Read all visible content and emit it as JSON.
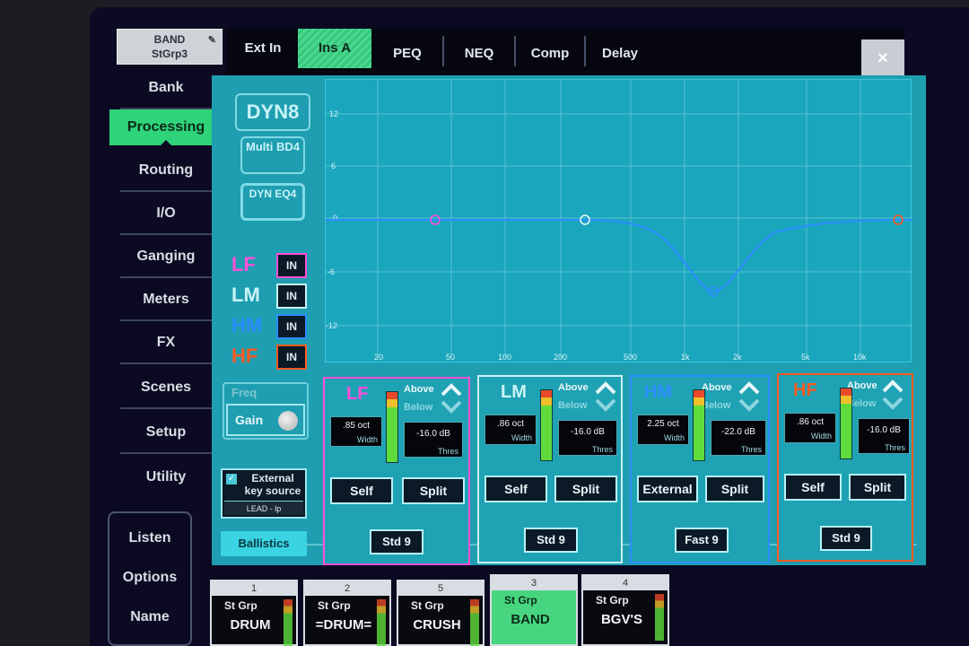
{
  "channel": {
    "line1": "BAND",
    "line2": "StGrp3"
  },
  "sidebar": {
    "items": [
      "Bank",
      "Processing",
      "Routing",
      "I/O",
      "Ganging",
      "Meters",
      "FX",
      "Scenes",
      "Setup",
      "Utility"
    ],
    "bottom": [
      "Listen",
      "Options",
      "Name"
    ]
  },
  "tabs": [
    "Ext In",
    "Ins A",
    "PEQ",
    "NEQ",
    "Comp",
    "Delay"
  ],
  "close_label": "×",
  "dyn_logos": [
    "DYN8",
    "Multi BD4",
    "DYN EQ4"
  ],
  "bands": [
    {
      "label": "LF",
      "in": "IN",
      "color": "#ff4fd8"
    },
    {
      "label": "LM",
      "in": "IN",
      "color": "#c9f2f6"
    },
    {
      "label": "HM",
      "in": "IN",
      "color": "#2b8dff"
    },
    {
      "label": "HF",
      "in": "IN",
      "color": "#ff5a22"
    }
  ],
  "freq_label": "Freq",
  "gain_label": "Gain",
  "external_key": {
    "line1": "External",
    "line2": "key source",
    "source": "LEAD - lp"
  },
  "ballistics_label": "Ballistics",
  "graph": {
    "y_ticks": [
      "12",
      "6",
      "0",
      "-6",
      "-12"
    ],
    "x_ticks": [
      "20",
      "50",
      "100",
      "200",
      "500",
      "1k",
      "2k",
      "5k",
      "10k"
    ]
  },
  "band_panels": [
    {
      "name": "LF",
      "above": "Above",
      "below": "Below",
      "width": ".85 oct",
      "width_unit": "Width",
      "thres": "-16.0 dB",
      "thres_unit": "Thres",
      "btn1": "Self",
      "btn2": "Split",
      "mode": "Std 9",
      "color": "#ff4fd8"
    },
    {
      "name": "LM",
      "above": "Above",
      "below": "Below",
      "width": ".86 oct",
      "width_unit": "Width",
      "thres": "-16.0 dB",
      "thres_unit": "Thres",
      "btn1": "Self",
      "btn2": "Split",
      "mode": "Std 9",
      "color": "#c9f2f6"
    },
    {
      "name": "HM",
      "above": "Above",
      "below": "Below",
      "width": "2.25 oct",
      "width_unit": "Width",
      "thres": "-22.0 dB",
      "thres_unit": "Thres",
      "btn1": "External",
      "btn2": "Split",
      "mode": "Fast 9",
      "color": "#2b8dff"
    },
    {
      "name": "HF",
      "above": "Above",
      "below": "Below",
      "width": ".86 oct",
      "width_unit": "Width",
      "thres": "-16.0 dB",
      "thres_unit": "Thres",
      "btn1": "Self",
      "btn2": "Split",
      "mode": "Std 9",
      "color": "#ff5a22"
    }
  ],
  "strips": [
    {
      "num": "1",
      "grp": "St Grp",
      "name": "DRUM"
    },
    {
      "num": "2",
      "grp": "St Grp",
      "name": "=DRUM="
    },
    {
      "num": "5",
      "grp": "St Grp",
      "name": "CRUSH"
    },
    {
      "num": "3",
      "grp": "St Grp",
      "name": "BAND"
    },
    {
      "num": "4",
      "grp": "St Grp",
      "name": "BGV'S"
    }
  ]
}
